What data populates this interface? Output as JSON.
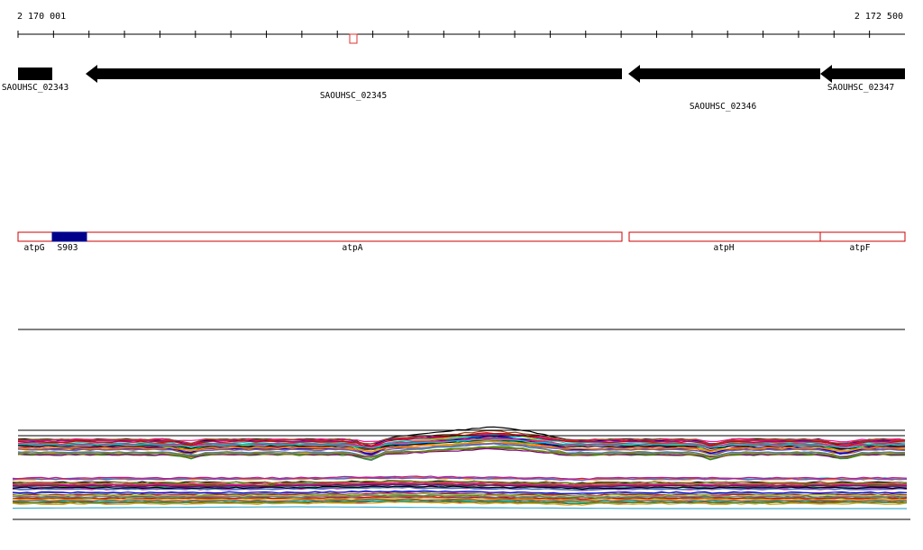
{
  "ruler": {
    "start_label": "2 170 001",
    "end_label": "2 172 500"
  },
  "genes": [
    {
      "name": "SAOUHSC_02343"
    },
    {
      "name": "SAOUHSC_02345"
    },
    {
      "name": "SAOUHSC_02346"
    },
    {
      "name": "SAOUHSC_02347"
    }
  ],
  "features": [
    {
      "name": "atpG"
    },
    {
      "name": "S903"
    },
    {
      "name": "atpA"
    },
    {
      "name": "atpH"
    },
    {
      "name": "atpF"
    }
  ],
  "colors": {
    "gene_arrow": "#000000",
    "feature_outline": "#cc0000",
    "highlight_feature": "#00008b",
    "marker": "#e03030"
  }
}
